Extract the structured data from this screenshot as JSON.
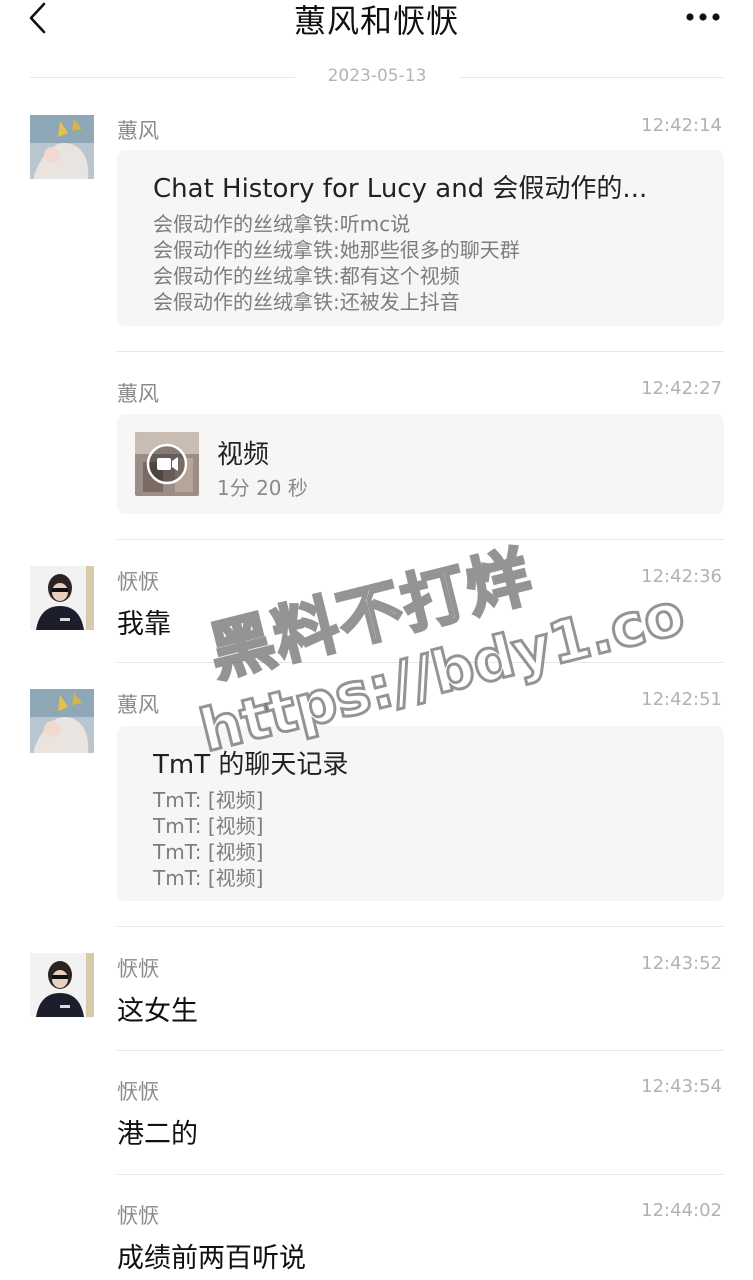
{
  "header": {
    "title": "蕙风和恹恹",
    "back_icon": "back-chevron-icon",
    "more_icon": "more-dots-icon"
  },
  "date_divider": "2023-05-13",
  "messages": [
    {
      "sender": "蕙风",
      "time": "12:42:14",
      "type": "chat_history",
      "card": {
        "title": "Chat History for Lucy and 会假动作的...",
        "lines": [
          "会假动作的丝绒拿铁:听mc说",
          "会假动作的丝绒拿铁:她那些很多的聊天群",
          "会假动作的丝绒拿铁:都有这个视频",
          "会假动作的丝绒拿铁:还被发上抖音"
        ]
      }
    },
    {
      "sender": "蕙风",
      "time": "12:42:27",
      "type": "video",
      "video": {
        "title": "视频",
        "duration": "1分 20 秒",
        "icon": "video-camera-icon"
      }
    },
    {
      "sender": "恹恹",
      "time": "12:42:36",
      "type": "text",
      "text": "我靠"
    },
    {
      "sender": "蕙风",
      "time": "12:42:51",
      "type": "chat_history",
      "card": {
        "title": "TmT 的聊天记录",
        "lines": [
          "TmT: [视频]",
          "TmT: [视频]",
          "TmT: [视频]",
          "TmT: [视频]"
        ]
      }
    },
    {
      "sender": "恹恹",
      "time": "12:43:52",
      "type": "text",
      "text": "这女生"
    },
    {
      "sender": "恹恹",
      "time": "12:43:54",
      "type": "text",
      "text": "港二的"
    },
    {
      "sender": "恹恹",
      "time": "12:44:02",
      "type": "text",
      "text": "成绩前两百听说"
    }
  ],
  "watermark": {
    "line1": "黑料不打烊",
    "line2": "https://bdy1.co"
  }
}
